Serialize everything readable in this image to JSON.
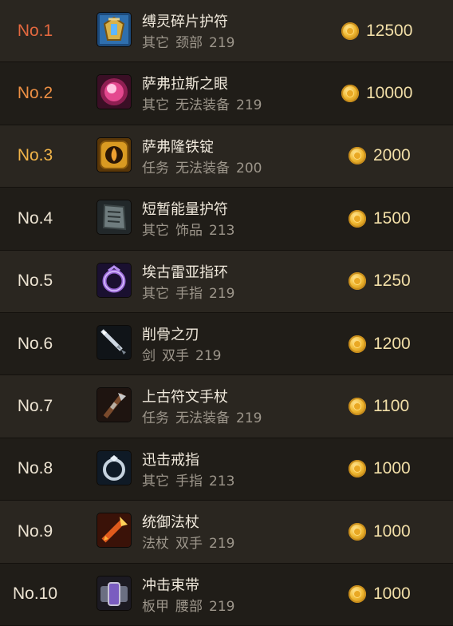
{
  "colors": {
    "rank_1": "#e4683f",
    "rank_2": "#ec8f44",
    "rank_3": "#f1b449",
    "rank_default": "#ece3d2",
    "row_a": "#2a2620",
    "row_b": "#201d18"
  },
  "items": [
    {
      "rank": "No.1",
      "name": "缚灵碎片护符",
      "type": "其它",
      "slot": "颈部",
      "level": "219",
      "price": "12500",
      "icon": "amulet-icon"
    },
    {
      "rank": "No.2",
      "name": "萨弗拉斯之眼",
      "type": "其它",
      "slot": "无法装备",
      "level": "219",
      "price": "10000",
      "icon": "glowing-orb-icon"
    },
    {
      "rank": "No.3",
      "name": "萨弗隆铁锭",
      "type": "任务",
      "slot": "无法装备",
      "level": "200",
      "price": "2000",
      "icon": "fire-ingot-icon"
    },
    {
      "rank": "No.4",
      "name": "短暂能量护符",
      "type": "其它",
      "slot": "饰品",
      "level": "213",
      "price": "1500",
      "icon": "stone-tablet-icon"
    },
    {
      "rank": "No.5",
      "name": "埃古雷亚指环",
      "type": "其它",
      "slot": "手指",
      "level": "219",
      "price": "1250",
      "icon": "purple-ring-icon"
    },
    {
      "rank": "No.6",
      "name": "削骨之刃",
      "type": "剑",
      "slot": "双手",
      "level": "219",
      "price": "1200",
      "icon": "sword-icon"
    },
    {
      "rank": "No.7",
      "name": "上古符文手杖",
      "type": "任务",
      "slot": "无法装备",
      "level": "219",
      "price": "1100",
      "icon": "staff-icon"
    },
    {
      "rank": "No.8",
      "name": "迅击戒指",
      "type": "其它",
      "slot": "手指",
      "level": "213",
      "price": "1000",
      "icon": "silver-ring-icon"
    },
    {
      "rank": "No.9",
      "name": "统御法杖",
      "type": "法杖",
      "slot": "双手",
      "level": "219",
      "price": "1000",
      "icon": "fire-staff-icon"
    },
    {
      "rank": "No.10",
      "name": "冲击束带",
      "type": "板甲",
      "slot": "腰部",
      "level": "219",
      "price": "1000",
      "icon": "belt-icon"
    }
  ]
}
